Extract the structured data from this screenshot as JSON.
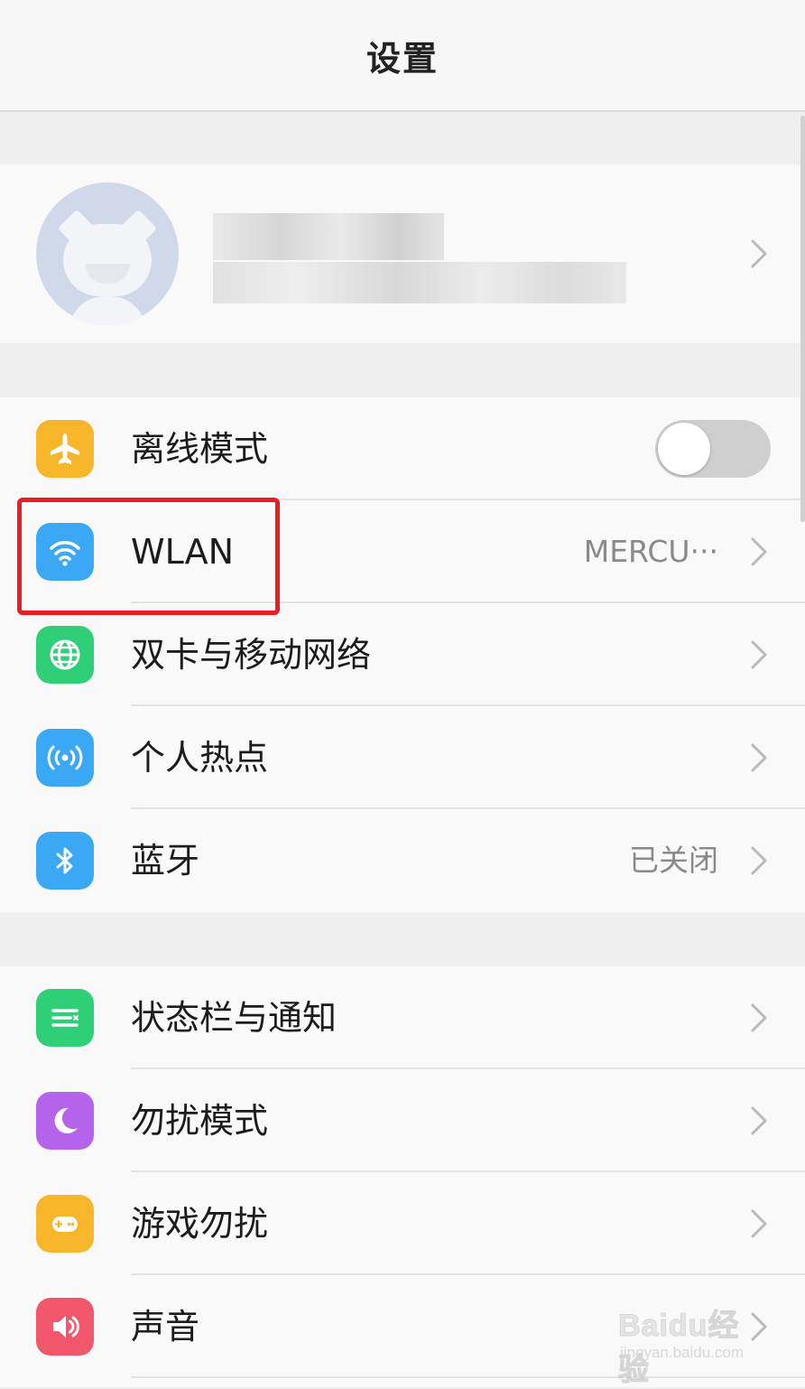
{
  "header": {
    "title": "设置"
  },
  "colors": {
    "airplane": "#f7b52a",
    "wlan": "#3aa8f5",
    "mobile": "#2fcf78",
    "hotspot": "#3aa8f5",
    "bluetooth": "#3aa8f5",
    "statusbar": "#2fcf78",
    "dnd": "#b463ea",
    "game": "#f7b52a",
    "sound": "#f1566b",
    "highlight": "#ec1c24"
  },
  "profile": {
    "avatar_icon": "avatar-cat-icon"
  },
  "groups": [
    {
      "items": [
        {
          "label": "离线模式",
          "icon": "airplane-icon",
          "toggle_on": false
        },
        {
          "label": "WLAN",
          "icon": "wifi-icon",
          "value": "MERCU···"
        },
        {
          "label": "双卡与移动网络",
          "icon": "globe-icon"
        },
        {
          "label": "个人热点",
          "icon": "hotspot-icon"
        },
        {
          "label": "蓝牙",
          "icon": "bluetooth-icon",
          "value": "已关闭"
        }
      ]
    },
    {
      "items": [
        {
          "label": "状态栏与通知",
          "icon": "notification-list-icon"
        },
        {
          "label": "勿扰模式",
          "icon": "moon-icon"
        },
        {
          "label": "游戏勿扰",
          "icon": "gamepad-icon"
        },
        {
          "label": "声音",
          "icon": "speaker-icon"
        }
      ]
    }
  ],
  "watermark": {
    "brand": "Baidu经验",
    "url": "jingyan.baidu.com"
  }
}
